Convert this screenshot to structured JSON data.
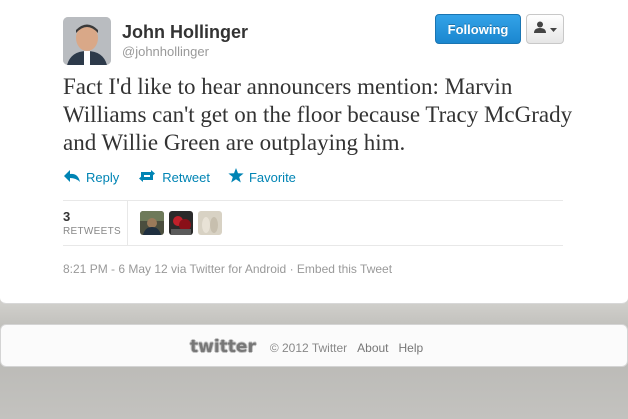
{
  "user": {
    "fullname": "John Hollinger",
    "screen_name": "@johnhollinger"
  },
  "buttons": {
    "follow_label": "Following",
    "user_dropdown_icon": "person-icon"
  },
  "tweet": {
    "text": "Fact I'd like to hear announcers mention: Marvin Williams can't get on the floor because Tracy McGrady and Willie Green are outplaying him."
  },
  "actions": {
    "reply_label": "Reply",
    "retweet_label": "Retweet",
    "favorite_label": "Favorite"
  },
  "stats": {
    "retweet_count": "3",
    "retweet_label": "RETWEETS"
  },
  "meta": {
    "timestamp": "8:21 PM - 6 May 12",
    "via": " via ",
    "source": "Twitter for Android",
    "separator": " · ",
    "embed_label": "Embed this Tweet"
  },
  "footer": {
    "logo_text": "twitter",
    "copyright": "© 2012 Twitter",
    "about_label": "About",
    "help_label": "Help"
  },
  "colors": {
    "link": "#0084b4",
    "follow_button": "#2b9ae0"
  }
}
